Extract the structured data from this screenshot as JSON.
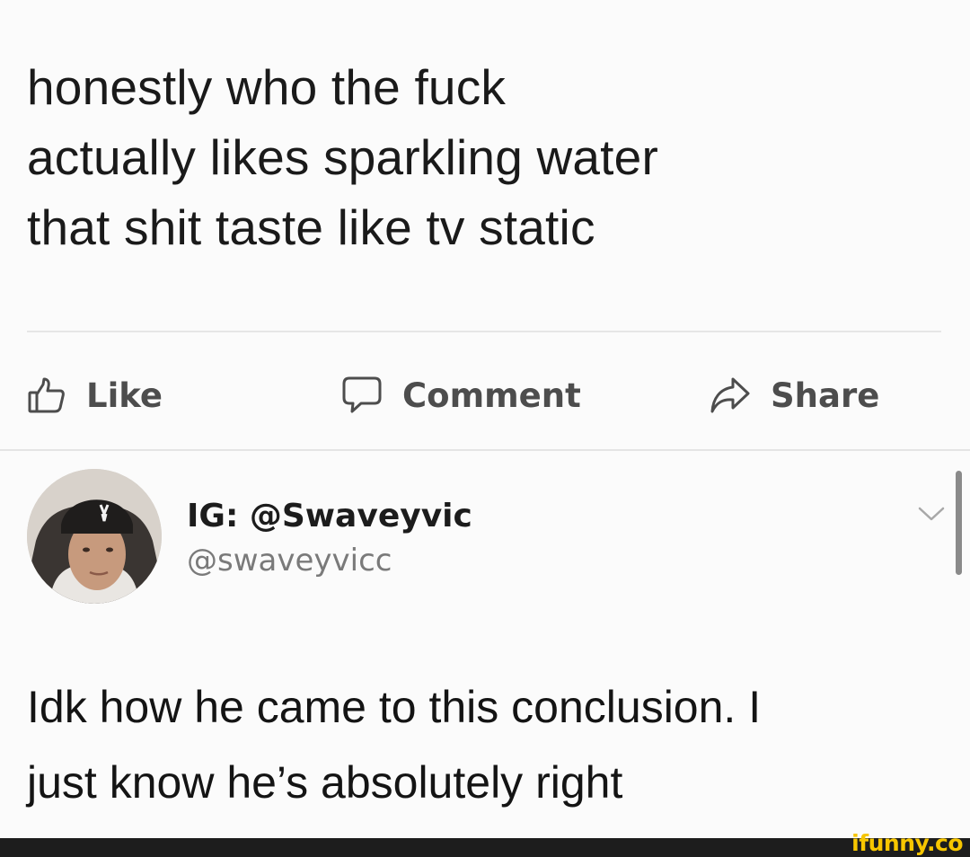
{
  "post": {
    "lines": [
      "honestly who the fuck",
      "actually likes sparkling water",
      "that shit taste like tv static"
    ]
  },
  "actions": {
    "like": {
      "label": "Like",
      "icon": "thumbs-up-icon"
    },
    "comment": {
      "label": "Comment",
      "icon": "speech-bubble-icon"
    },
    "share": {
      "label": "Share",
      "icon": "share-arrow-icon"
    }
  },
  "tweet": {
    "display_name": "IG: @Swaveyvic",
    "handle": "@swaveyvicc",
    "menu_icon": "chevron-down-icon",
    "lines": [
      "Idk how he came to this conclusion. I",
      "just know he’s absolutely right"
    ]
  },
  "watermark": {
    "text": "ifunny.co",
    "color": "#f7c600"
  }
}
